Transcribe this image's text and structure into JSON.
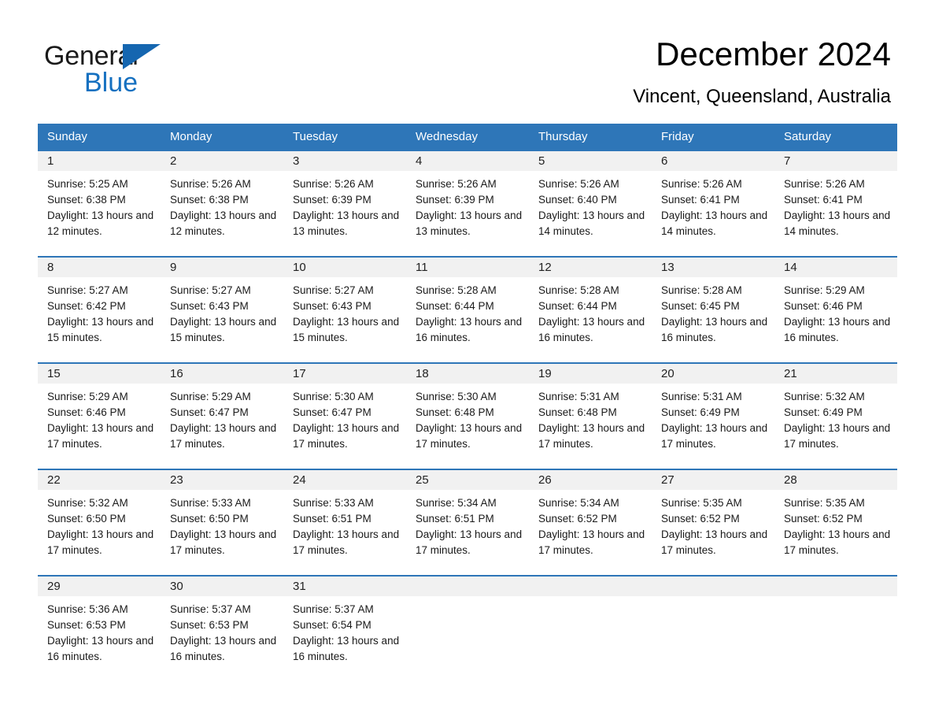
{
  "brand": {
    "name_top": "General",
    "name_bottom": "Blue",
    "accent_color": "#1570c0",
    "triangle_color": "#1566b0"
  },
  "header": {
    "title": "December 2024",
    "subtitle": "Vincent, Queensland, Australia"
  },
  "theme": {
    "header_blue": "#2e76b8",
    "day_band_gray": "#f1f1f1",
    "text_black": "#000000"
  },
  "weekdays": [
    "Sunday",
    "Monday",
    "Tuesday",
    "Wednesday",
    "Thursday",
    "Friday",
    "Saturday"
  ],
  "weeks": [
    [
      {
        "day": "1",
        "sunrise": "Sunrise: 5:25 AM",
        "sunset": "Sunset: 6:38 PM",
        "daylight": "Daylight: 13 hours and 12 minutes."
      },
      {
        "day": "2",
        "sunrise": "Sunrise: 5:26 AM",
        "sunset": "Sunset: 6:38 PM",
        "daylight": "Daylight: 13 hours and 12 minutes."
      },
      {
        "day": "3",
        "sunrise": "Sunrise: 5:26 AM",
        "sunset": "Sunset: 6:39 PM",
        "daylight": "Daylight: 13 hours and 13 minutes."
      },
      {
        "day": "4",
        "sunrise": "Sunrise: 5:26 AM",
        "sunset": "Sunset: 6:39 PM",
        "daylight": "Daylight: 13 hours and 13 minutes."
      },
      {
        "day": "5",
        "sunrise": "Sunrise: 5:26 AM",
        "sunset": "Sunset: 6:40 PM",
        "daylight": "Daylight: 13 hours and 14 minutes."
      },
      {
        "day": "6",
        "sunrise": "Sunrise: 5:26 AM",
        "sunset": "Sunset: 6:41 PM",
        "daylight": "Daylight: 13 hours and 14 minutes."
      },
      {
        "day": "7",
        "sunrise": "Sunrise: 5:26 AM",
        "sunset": "Sunset: 6:41 PM",
        "daylight": "Daylight: 13 hours and 14 minutes."
      }
    ],
    [
      {
        "day": "8",
        "sunrise": "Sunrise: 5:27 AM",
        "sunset": "Sunset: 6:42 PM",
        "daylight": "Daylight: 13 hours and 15 minutes."
      },
      {
        "day": "9",
        "sunrise": "Sunrise: 5:27 AM",
        "sunset": "Sunset: 6:43 PM",
        "daylight": "Daylight: 13 hours and 15 minutes."
      },
      {
        "day": "10",
        "sunrise": "Sunrise: 5:27 AM",
        "sunset": "Sunset: 6:43 PM",
        "daylight": "Daylight: 13 hours and 15 minutes."
      },
      {
        "day": "11",
        "sunrise": "Sunrise: 5:28 AM",
        "sunset": "Sunset: 6:44 PM",
        "daylight": "Daylight: 13 hours and 16 minutes."
      },
      {
        "day": "12",
        "sunrise": "Sunrise: 5:28 AM",
        "sunset": "Sunset: 6:44 PM",
        "daylight": "Daylight: 13 hours and 16 minutes."
      },
      {
        "day": "13",
        "sunrise": "Sunrise: 5:28 AM",
        "sunset": "Sunset: 6:45 PM",
        "daylight": "Daylight: 13 hours and 16 minutes."
      },
      {
        "day": "14",
        "sunrise": "Sunrise: 5:29 AM",
        "sunset": "Sunset: 6:46 PM",
        "daylight": "Daylight: 13 hours and 16 minutes."
      }
    ],
    [
      {
        "day": "15",
        "sunrise": "Sunrise: 5:29 AM",
        "sunset": "Sunset: 6:46 PM",
        "daylight": "Daylight: 13 hours and 17 minutes."
      },
      {
        "day": "16",
        "sunrise": "Sunrise: 5:29 AM",
        "sunset": "Sunset: 6:47 PM",
        "daylight": "Daylight: 13 hours and 17 minutes."
      },
      {
        "day": "17",
        "sunrise": "Sunrise: 5:30 AM",
        "sunset": "Sunset: 6:47 PM",
        "daylight": "Daylight: 13 hours and 17 minutes."
      },
      {
        "day": "18",
        "sunrise": "Sunrise: 5:30 AM",
        "sunset": "Sunset: 6:48 PM",
        "daylight": "Daylight: 13 hours and 17 minutes."
      },
      {
        "day": "19",
        "sunrise": "Sunrise: 5:31 AM",
        "sunset": "Sunset: 6:48 PM",
        "daylight": "Daylight: 13 hours and 17 minutes."
      },
      {
        "day": "20",
        "sunrise": "Sunrise: 5:31 AM",
        "sunset": "Sunset: 6:49 PM",
        "daylight": "Daylight: 13 hours and 17 minutes."
      },
      {
        "day": "21",
        "sunrise": "Sunrise: 5:32 AM",
        "sunset": "Sunset: 6:49 PM",
        "daylight": "Daylight: 13 hours and 17 minutes."
      }
    ],
    [
      {
        "day": "22",
        "sunrise": "Sunrise: 5:32 AM",
        "sunset": "Sunset: 6:50 PM",
        "daylight": "Daylight: 13 hours and 17 minutes."
      },
      {
        "day": "23",
        "sunrise": "Sunrise: 5:33 AM",
        "sunset": "Sunset: 6:50 PM",
        "daylight": "Daylight: 13 hours and 17 minutes."
      },
      {
        "day": "24",
        "sunrise": "Sunrise: 5:33 AM",
        "sunset": "Sunset: 6:51 PM",
        "daylight": "Daylight: 13 hours and 17 minutes."
      },
      {
        "day": "25",
        "sunrise": "Sunrise: 5:34 AM",
        "sunset": "Sunset: 6:51 PM",
        "daylight": "Daylight: 13 hours and 17 minutes."
      },
      {
        "day": "26",
        "sunrise": "Sunrise: 5:34 AM",
        "sunset": "Sunset: 6:52 PM",
        "daylight": "Daylight: 13 hours and 17 minutes."
      },
      {
        "day": "27",
        "sunrise": "Sunrise: 5:35 AM",
        "sunset": "Sunset: 6:52 PM",
        "daylight": "Daylight: 13 hours and 17 minutes."
      },
      {
        "day": "28",
        "sunrise": "Sunrise: 5:35 AM",
        "sunset": "Sunset: 6:52 PM",
        "daylight": "Daylight: 13 hours and 17 minutes."
      }
    ],
    [
      {
        "day": "29",
        "sunrise": "Sunrise: 5:36 AM",
        "sunset": "Sunset: 6:53 PM",
        "daylight": "Daylight: 13 hours and 16 minutes."
      },
      {
        "day": "30",
        "sunrise": "Sunrise: 5:37 AM",
        "sunset": "Sunset: 6:53 PM",
        "daylight": "Daylight: 13 hours and 16 minutes."
      },
      {
        "day": "31",
        "sunrise": "Sunrise: 5:37 AM",
        "sunset": "Sunset: 6:54 PM",
        "daylight": "Daylight: 13 hours and 16 minutes."
      },
      {
        "day": "",
        "sunrise": "",
        "sunset": "",
        "daylight": ""
      },
      {
        "day": "",
        "sunrise": "",
        "sunset": "",
        "daylight": ""
      },
      {
        "day": "",
        "sunrise": "",
        "sunset": "",
        "daylight": ""
      },
      {
        "day": "",
        "sunrise": "",
        "sunset": "",
        "daylight": ""
      }
    ]
  ]
}
